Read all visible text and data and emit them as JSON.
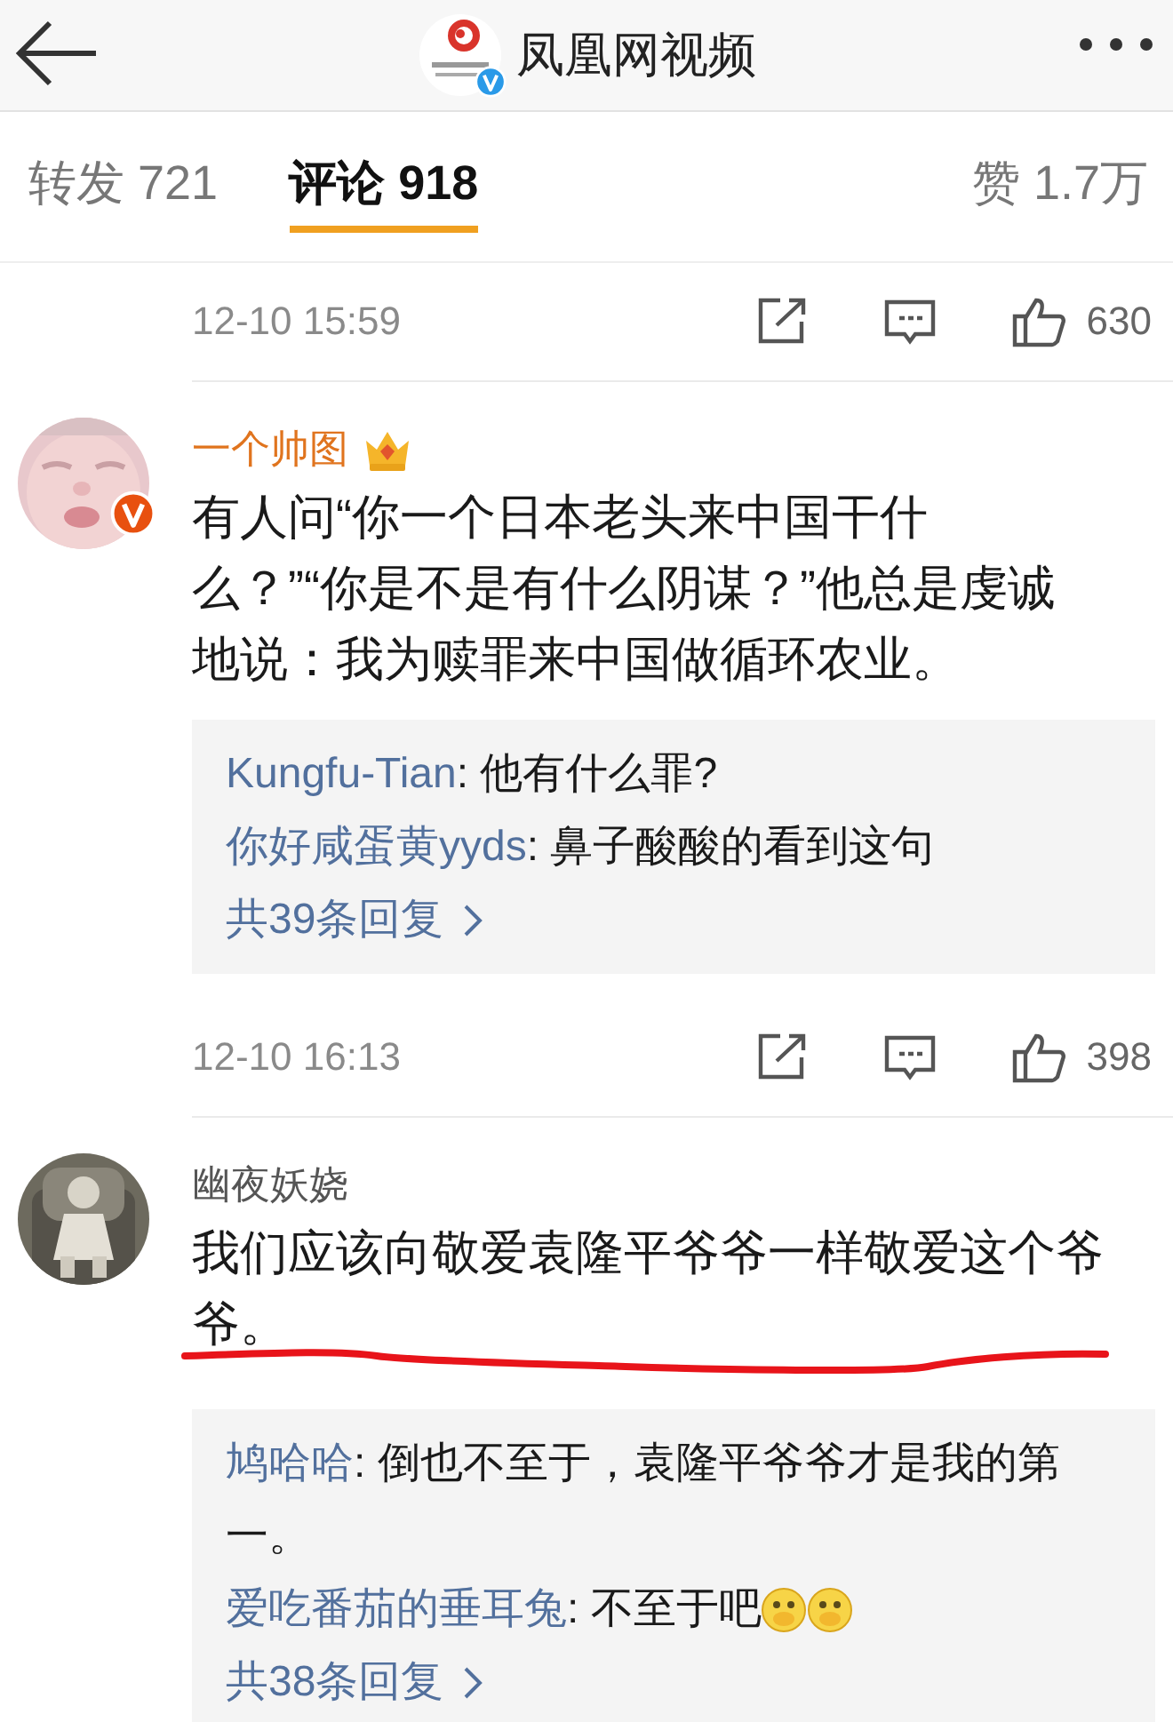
{
  "header": {
    "title": "凤凰网视频",
    "verified": true
  },
  "tabs": [
    {
      "label": "转发 721",
      "selected": false
    },
    {
      "label": "评论 918",
      "selected": true
    },
    {
      "label": "赞 1.7万",
      "selected": false
    }
  ],
  "previous_actions": {
    "time": "12-10 15:59",
    "likes": "630"
  },
  "comments": [
    {
      "name": "一个帅图",
      "vip": true,
      "verified": true,
      "text": "有人问“你一个日本老头来中国干什么？”“你是不是有什么阴谋？”他总是虔诚地说：我为赎罪来中国做循环农业。",
      "underlined": false,
      "replies": [
        {
          "user": "Kungfu-Tian",
          "text": ": 他有什么罪?"
        },
        {
          "user": "你好咸蛋黄yyds",
          "text": ": 鼻子酸酸的看到这句"
        }
      ],
      "more": "共39条回复",
      "time": "12-10 16:13",
      "likes": "398"
    },
    {
      "name": "幽夜妖娆",
      "vip": false,
      "verified": false,
      "text": "我们应该向敬爱袁隆平爷爷一样敬爱这个爷爷。",
      "underlined": true,
      "replies": [
        {
          "user": "鸠哈哈",
          "text": ": 倒也不至于，袁隆平爷爷才是我的第一。"
        },
        {
          "user": "爱吃番茄的垂耳兔",
          "text": ": 不至于吧",
          "icons": [
            {
              "kind": "emoji"
            },
            {
              "kind": "emoji"
            }
          ]
        }
      ],
      "more": "共38条回复"
    }
  ]
}
